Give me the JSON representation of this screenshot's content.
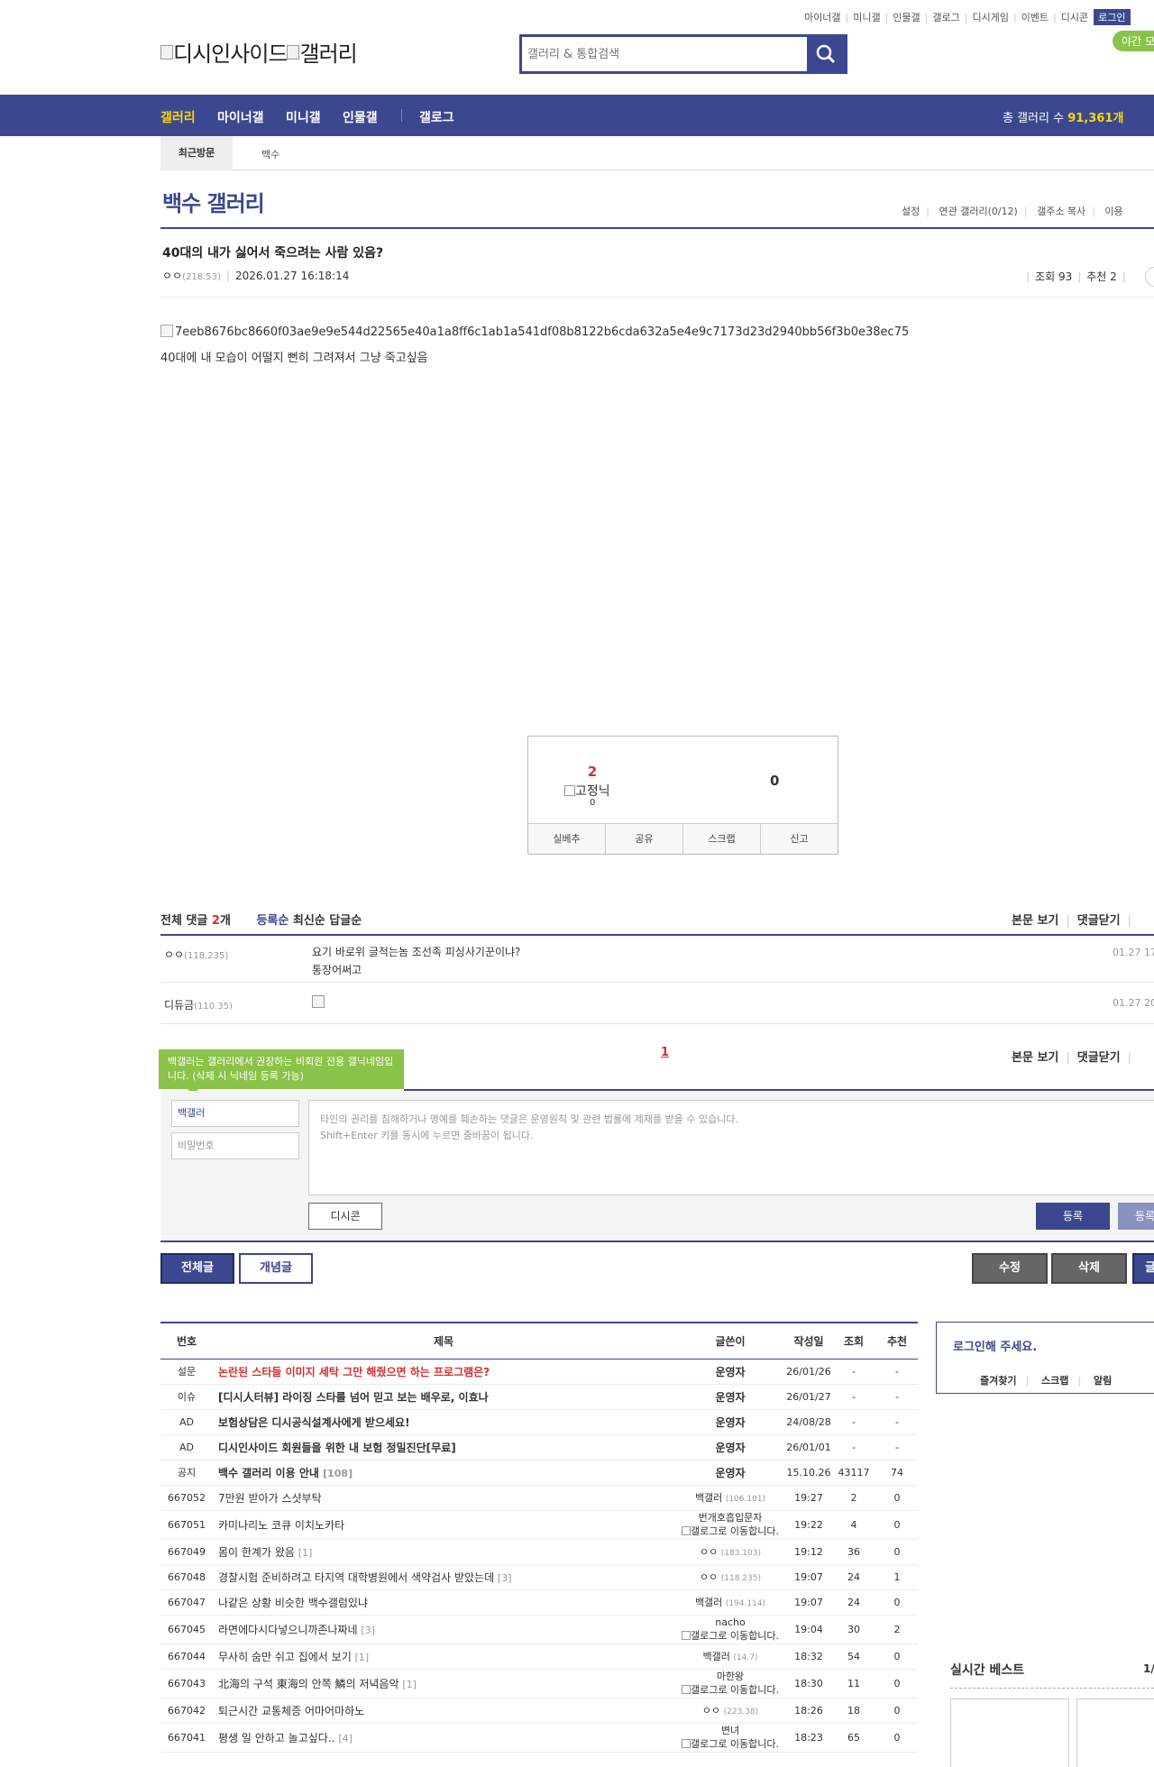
{
  "header": {
    "top_links": [
      "마이너갤",
      "미니갤",
      "인물갤",
      "갤로그",
      "디시게임",
      "이벤트",
      "디시콘"
    ],
    "login_label": "로그인",
    "night_mode_label": "야간 모",
    "logo_text": "디시인사이드",
    "logo_text2": "갤러리",
    "search_placeholder": "갤러리 & 통합검색"
  },
  "nav": {
    "items": [
      "갤러리",
      "마이너갤",
      "미니갤",
      "인물갤",
      "갤로그"
    ],
    "count_label": "총 갤러리 수 ",
    "count_value": "91,361개"
  },
  "recent": {
    "tab_label": "최근방문",
    "item": "백수"
  },
  "gallery": {
    "title": "백수 갤러리",
    "links": [
      "설정",
      "연관 갤러리(0/12)",
      "갤주소 복사",
      "이용"
    ]
  },
  "post": {
    "title": "40대의 내가 싫어서 죽으려는 사람 있음?",
    "writer": "ㅇㅇ",
    "writer_ip": "(218.53)",
    "date": "2026.01.27 16:18:14",
    "views": "조회 93",
    "recommend": "추천 2",
    "image_alt": "7eeb8676bc8660f03ae9e9e544d22565e40a1a8ff6c1ab1a541df08b8122b6cda632a5e4e9c7173d23d2940bb56f3b0e38ec75",
    "body": "40대에 내 모습이 어떨지 뻔히 그려져서 그냥 죽고싶음"
  },
  "vote": {
    "up": "2",
    "fixed_label": "고정닉",
    "fixed_count": "0",
    "down": "0",
    "buttons": [
      "실베추",
      "공유",
      "스크랩",
      "신고"
    ]
  },
  "comments": {
    "total_label": "전체 댓글",
    "total_count": "2",
    "total_unit": "개",
    "sort_options": [
      "등록순",
      "최신순",
      "답글순"
    ],
    "right_links": [
      "본문 보기",
      "댓글닫기"
    ],
    "items": [
      {
        "writer": "ㅇㅇ",
        "ip": "(118.235)",
        "text": "요기 바로위 글적는놈 조선족 피싱사기꾼이냐?",
        "text2": "통장어써고",
        "date": "01.27 17"
      },
      {
        "writer": "디듀금",
        "ip": "(110.35)",
        "text": "",
        "text2": "",
        "date": "01.27 20"
      }
    ],
    "page": "1",
    "tooltip": "백갤러는 갤러리에서 권장하는 비회원 전용 갤닉네임입니다. (삭제 시 닉네임 등록 가능)",
    "nick_value": "백갤러",
    "password_placeholder": "비밀번호",
    "textarea_placeholder1": "타인의 권리를 침해하거나 명예를 훼손하는 댓글은 운영원칙 및 관련 법률에 제재를 받을 수 있습니다.",
    "textarea_placeholder2": "Shift+Enter 키를 동시에 누르면 줄바꿈이 됩니다.",
    "dccon_label": "디시콘",
    "submit_label": "등록",
    "submit2_label": "등록"
  },
  "actions": {
    "all": "전체글",
    "concept": "개념글",
    "edit": "수정",
    "delete": "삭제",
    "write": "글"
  },
  "list": {
    "headers": [
      "번호",
      "제목",
      "글쓴이",
      "작성일",
      "조회",
      "추천"
    ],
    "rows": [
      {
        "num": "설문",
        "subject": "논란된 스타들 이미지 세탁 그만 해줬으면 하는 프로그램은?",
        "style": "red",
        "writer": "운영자",
        "bold_writer": true,
        "date": "26/01/26",
        "views": "-",
        "rec": "-"
      },
      {
        "num": "이슈",
        "subject": "[디시人터뷰] 라이징 스타를 넘어 믿고 보는 배우로, 이효나",
        "style": "bold",
        "writer": "운영자",
        "bold_writer": true,
        "date": "26/01/27",
        "views": "-",
        "rec": "-"
      },
      {
        "num": "AD",
        "subject": "보험상담은 디시공식설계사에게 받으세요!",
        "style": "bold",
        "writer": "운영자",
        "bold_writer": true,
        "date": "24/08/28",
        "views": "-",
        "rec": "-"
      },
      {
        "num": "AD",
        "subject": "디시인사이드 회원들을 위한 내 보험 정밀진단[무료]",
        "style": "bold",
        "writer": "운영자",
        "bold_writer": true,
        "date": "26/01/01",
        "views": "-",
        "rec": "-"
      },
      {
        "num": "공지",
        "subject": "백수 갤러리 이용 안내",
        "reply": "[108]",
        "style": "bold",
        "writer": "운영자",
        "bold_writer": true,
        "date": "15.10.26",
        "views": "43117",
        "rec": "74"
      },
      {
        "num": "667052",
        "subject": "7만원 받아가 스샷부탁",
        "style": "",
        "writer": "백갤러",
        "ip": "(106.101)",
        "date": "19:27",
        "views": "2",
        "rec": "0"
      },
      {
        "num": "667051",
        "subject": "카미나리노 코큐 이치노카타",
        "style": "",
        "writer": "번개호흡입문자",
        "writer2": "갤로그로 이동합니다.",
        "date": "19:22",
        "views": "4",
        "rec": "0"
      },
      {
        "num": "667049",
        "subject": "몸이 한계가 왔음",
        "reply": "[1]",
        "style": "",
        "writer": "ㅇㅇ",
        "ip": "(183.103)",
        "date": "19:12",
        "views": "36",
        "rec": "0"
      },
      {
        "num": "667048",
        "subject": "경찰시험 준비하려고 타지역 대학병원에서 색약검사 받았는데",
        "reply": "[3]",
        "style": "",
        "writer": "ㅇㅇ",
        "ip": "(118.235)",
        "date": "19:07",
        "views": "24",
        "rec": "1"
      },
      {
        "num": "667047",
        "subject": "나같은 상황 비슷한 백수갤럼있냐",
        "style": "",
        "writer": "백갤러",
        "ip": "(194.114)",
        "date": "19:07",
        "views": "24",
        "rec": "0"
      },
      {
        "num": "667045",
        "subject": "라면에다시다넣으니까존나짜네",
        "reply": "[3]",
        "style": "",
        "writer": "nacho",
        "writer2": "갤로그로 이동합니다.",
        "date": "19:04",
        "views": "30",
        "rec": "2"
      },
      {
        "num": "667044",
        "subject": "무사히 숨만 쉬고 집에서 보기",
        "reply": "[1]",
        "style": "",
        "writer": "백갤러",
        "ip": "(14.7)",
        "date": "18:32",
        "views": "54",
        "rec": "0"
      },
      {
        "num": "667043",
        "subject": "北海의 구석 東海의 안쪽 鱗의 저녁음악",
        "reply": "[1]",
        "style": "",
        "writer": "마한왕",
        "writer2": "갤로그로 이동합니다.",
        "date": "18:30",
        "views": "11",
        "rec": "0"
      },
      {
        "num": "667042",
        "subject": "퇴근시간 교통체증 어마어마하노",
        "style": "",
        "writer": "ㅇㅇ",
        "ip": "(223.38)",
        "date": "18:26",
        "views": "18",
        "rec": "0"
      },
      {
        "num": "667041",
        "subject": "평생 일 안하고 놀고싶다..",
        "reply": "[4]",
        "style": "",
        "writer": "변녀",
        "writer2": "갤로그로 이동합니다.",
        "date": "18:23",
        "views": "65",
        "rec": "0"
      }
    ]
  },
  "sidebar": {
    "login_prompt": "로그인해 주세요.",
    "login_links": [
      "즐겨찾기",
      "스크랩",
      "알림"
    ],
    "best_title": "실시간 베스트",
    "best_page": "1/"
  },
  "colors": {
    "primary": "#3b4890",
    "accent": "#ffd800",
    "alert": "#d32f2f",
    "green": "#8bc34a"
  }
}
